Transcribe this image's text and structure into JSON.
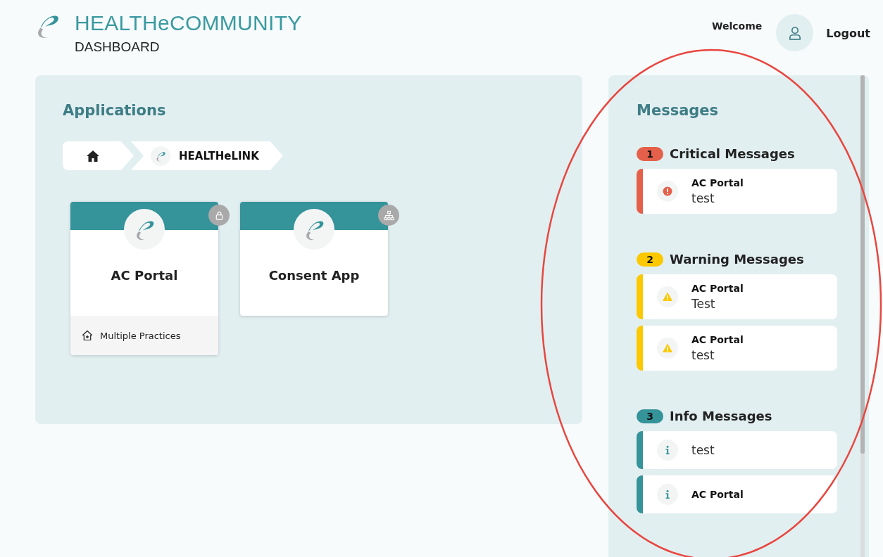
{
  "header": {
    "brand": "HEALTHeCOMMUNITY",
    "subtitle": "DASHBOARD",
    "welcome": "Welcome",
    "logout": "Logout"
  },
  "applications": {
    "title": "Applications",
    "breadcrumb": [
      {
        "kind": "home"
      },
      {
        "kind": "app",
        "label": "HEALTHeLINK"
      }
    ],
    "apps": [
      {
        "name": "AC Portal",
        "badge": {
          "kind": "lock"
        },
        "footer": "Multiple Practices"
      },
      {
        "name": "Consent App",
        "badge": {
          "kind": "network"
        }
      }
    ]
  },
  "messages": {
    "title": "Messages",
    "groups": [
      {
        "kind": "critical",
        "count": "1",
        "title": "Critical Messages",
        "color": "#e5604a",
        "items": [
          {
            "title": "AC Portal",
            "body": "test"
          }
        ]
      },
      {
        "kind": "warning",
        "count": "2",
        "title": "Warning Messages",
        "color": "#fcc800",
        "items": [
          {
            "title": "AC Portal",
            "body": "Test"
          },
          {
            "title": "AC Portal",
            "body": "test"
          }
        ]
      },
      {
        "kind": "info",
        "count": "3",
        "title": "Info Messages",
        "color": "#35939a",
        "items": [
          {
            "body": "test"
          },
          {
            "title": "AC Portal"
          }
        ]
      }
    ]
  }
}
